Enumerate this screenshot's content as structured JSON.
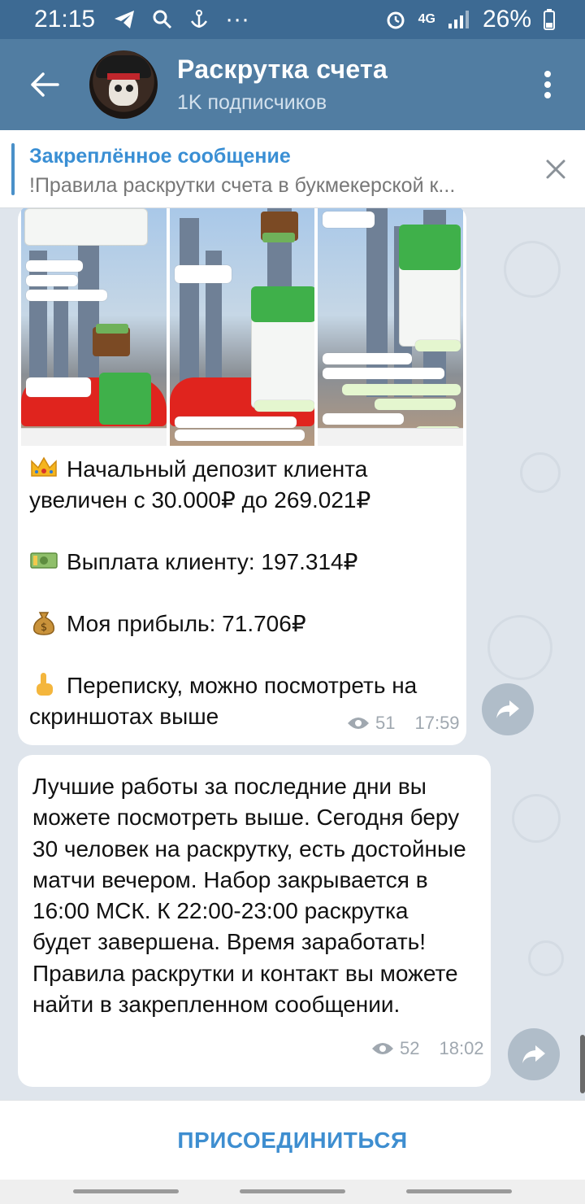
{
  "status_bar": {
    "time": "21:15",
    "network": "4G",
    "battery": "26%",
    "more": "···"
  },
  "header": {
    "title": "Раскрутка счета",
    "subtitle": "1K подписчиков"
  },
  "pinned": {
    "title": "Закреплённое сообщение",
    "text": "!Правила раскрутки счета в букмекерской к..."
  },
  "messages": [
    {
      "lines": [
        "Начальный депозит клиента увеличен с 30.000₽ до 269.021₽",
        "Выплата клиенту: 197.314₽",
        "Моя прибыль: 71.706₽",
        "Переписку, можно посмотреть на скриншотах выше"
      ],
      "icons": [
        "crown-emoji",
        "money-emoji",
        "money-bag-emoji",
        "pointing-up-emoji"
      ],
      "views": "51",
      "time": "17:59"
    },
    {
      "text": "Лучшие работы за последние дни вы можете посмотреть выше. Сегодня беру 30 человек на раскрутку, есть достойные матчи вечером. Набор закрывается в 16:00 МСК. К 22:00-23:00 раскрутка будет завершена. Время заработать! Правила раскрутки и контакт вы можете найти в закрепленном сообщении.",
      "views": "52",
      "time": "18:02"
    }
  ],
  "join_button": "ПРИСОЕДИНИТЬСЯ",
  "colors": {
    "header": "#517da2",
    "status_bar": "#3d6a93",
    "accent": "#3e8ed0",
    "chat_bg": "#dfe5ec"
  }
}
